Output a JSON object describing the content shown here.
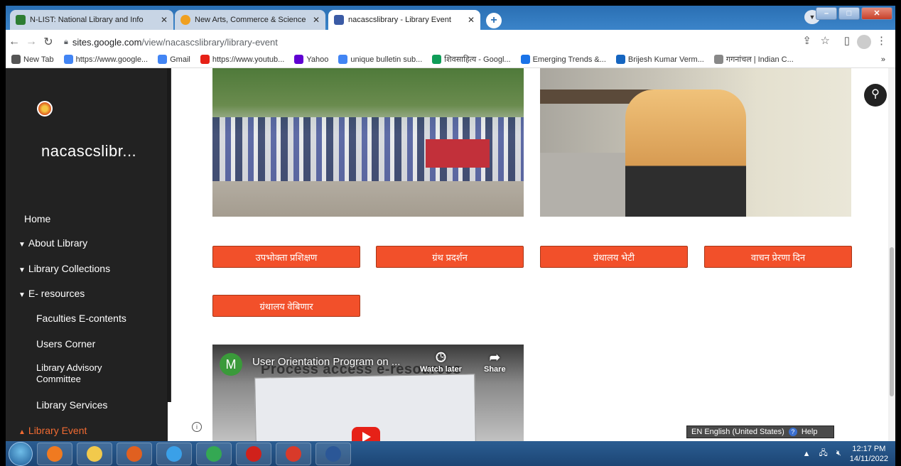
{
  "browser": {
    "tabs": [
      {
        "title": "N-LIST: National Library and Info",
        "favicon_color": "#2e7d32"
      },
      {
        "title": "New Arts, Commerce & Science",
        "favicon_color": "#f0a020"
      },
      {
        "title": "nacascslibrary - Library Event",
        "favicon_color": "#3b5ba5"
      }
    ],
    "new_tab": "+",
    "window_controls": {
      "minimize": "–",
      "maximize": "□",
      "close": "✕"
    },
    "url_host": "sites.google.com",
    "url_path": "/view/nacascslibrary/library-event",
    "bookmarks": [
      {
        "label": "New Tab",
        "icon": "globe-icon",
        "color": "#555"
      },
      {
        "label": "https://www.google...",
        "icon": "google-icon",
        "color": "#4285f4"
      },
      {
        "label": "Gmail",
        "icon": "google-icon",
        "color": "#4285f4"
      },
      {
        "label": "https://www.youtub...",
        "icon": "youtube-icon",
        "color": "#e62117"
      },
      {
        "label": "Yahoo",
        "icon": "yahoo-icon",
        "color": "#6001d2"
      },
      {
        "label": "unique bulletin sub...",
        "icon": "google-icon",
        "color": "#4285f4"
      },
      {
        "label": "शिवसाहित्य - Googl...",
        "icon": "drive-icon",
        "color": "#0f9d58"
      },
      {
        "label": "Emerging Trends &...",
        "icon": "table-icon",
        "color": "#1a73e8"
      },
      {
        "label": "Brijesh Kumar Verm...",
        "icon": "cap-icon",
        "color": "#1565c0"
      },
      {
        "label": "गगनांचल | Indian C...",
        "icon": "emblem-icon",
        "color": "#888888"
      }
    ],
    "bookmarks_more": "»"
  },
  "sidebar": {
    "site_name": "nacascslibr...",
    "nav": [
      {
        "label": "Home",
        "chevron": ""
      },
      {
        "label": "About Library",
        "chevron": "▼"
      },
      {
        "label": "Library Collections",
        "chevron": "▼"
      },
      {
        "label": "E- resources",
        "chevron": "▼"
      },
      {
        "label": "Faculties E-contents",
        "chevron": ""
      },
      {
        "label": "Users Corner",
        "chevron": ""
      },
      {
        "label": "Library Advisory Committee",
        "chevron": ""
      },
      {
        "label": "Library Services",
        "chevron": ""
      },
      {
        "label": "Library Event",
        "chevron": "▲"
      }
    ]
  },
  "main": {
    "category_buttons": [
      "उपभोक्ता प्रशिक्षण",
      "ग्रंथ प्रदर्शन",
      "ग्रंथालय भेटी",
      "वाचन प्रेरणा दिन",
      "ग्रंथालय वेबिणार"
    ],
    "video": {
      "channel_initial": "M",
      "title": "User Orientation Program on ...",
      "watch_later": "Watch later",
      "share": "Share",
      "overlay_text": "Process access e-resources"
    },
    "info_icon": "i",
    "search_icon": "⚲"
  },
  "language_bar": {
    "lang": "EN English (United States)",
    "help": "Help"
  },
  "taskbar": {
    "time": "12:17 PM",
    "date": "14/11/2022",
    "apps": [
      {
        "name": "firefox-icon",
        "color": "#f07a20"
      },
      {
        "name": "file-explorer-icon",
        "color": "#f2c94c"
      },
      {
        "name": "media-player-icon",
        "color": "#e06020"
      },
      {
        "name": "internet-explorer-icon",
        "color": "#3aa0e8"
      },
      {
        "name": "chrome-icon",
        "color": "#34a853"
      },
      {
        "name": "acrobat-icon",
        "color": "#d0211b"
      },
      {
        "name": "paint-icon",
        "color": "#d83a2a"
      },
      {
        "name": "word-icon",
        "color": "#2b5797"
      }
    ]
  }
}
